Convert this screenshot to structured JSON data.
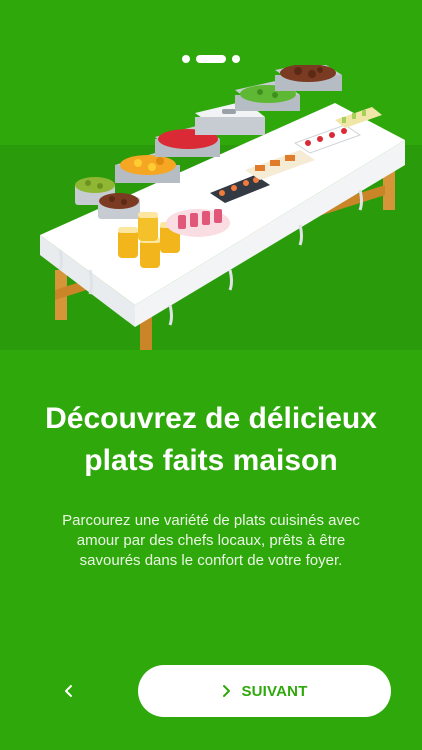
{
  "onboarding": {
    "pager": {
      "total": 3,
      "active": 2
    },
    "illustration": {
      "icon": "buffet-table-illustration"
    },
    "title_line1": "Découvrez de délicieux",
    "title_line2": "plats faits maison",
    "description": "Parcourez une variété de plats cuisinés avec amour par des chefs locaux, prêts à être savourés dans le confort de votre foyer.",
    "back_icon": "chevron-left-icon",
    "next_icon": "chevron-right-icon",
    "next_label": "SUIVANT"
  },
  "colors": {
    "background": "#2fa80c",
    "button_bg": "#ffffff",
    "button_text": "#2fa80c"
  }
}
